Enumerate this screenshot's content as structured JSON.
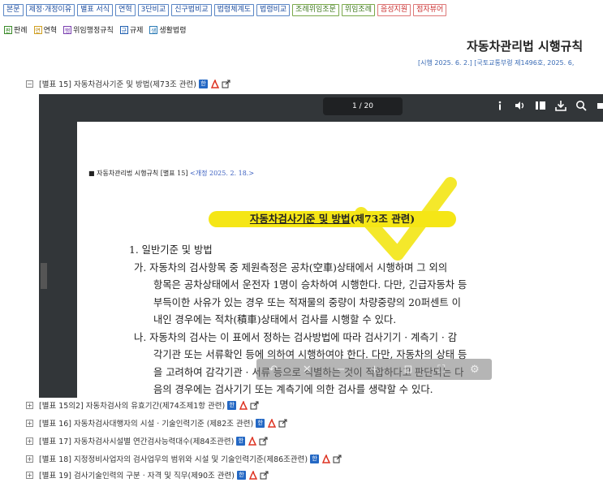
{
  "toolbar": {
    "buttons": [
      "본문",
      "제정·개정이유",
      "별표 서식",
      "연혁",
      "3단비교",
      "신구법비교",
      "법령체계도",
      "법령비교",
      "조례위임조문",
      "위임조례",
      "음성지원",
      "점자뷰어"
    ]
  },
  "legend": {
    "items": [
      {
        "icon": "판",
        "label": "판례"
      },
      {
        "icon": "연",
        "label": "연혁"
      },
      {
        "icon": "행",
        "label": "위임행정규칙"
      },
      {
        "icon": "규",
        "label": "규제"
      },
      {
        "icon": "생",
        "label": "생활법령"
      }
    ]
  },
  "law": {
    "title": "자동차관리법 시행규칙",
    "info": "[시행 2025. 6. 2.] [국토교통부령 제1496호, 2025. 6,"
  },
  "rows": {
    "top": "[별표 15] 자동차검사기준 및 방법(제73조 관련)",
    "list": [
      "[별표 15의2] 자동차검사의 유효기간(제74조제1항 관련)",
      "[별표 16] 자동차검사대행자의 시설 · 기술인력기준 (제82조 관련)",
      "[별표 17] 자동차검사시설별 연간검사능력대수(제84조관련)",
      "[별표 18] 지정정비사업자의 검사업무의 범위와 시설 및 기술인력기준(제86조관련)",
      "[별표 19] 검사기술인력의 구분 · 자격 및 직무(제90조 관련)"
    ]
  },
  "viewer": {
    "page_indicator": "1 / 20",
    "doc_header": "■ 자동차관리법 시행규칙 [별표 15]",
    "doc_revision": "<개정 2025. 2. 18.>",
    "doc_title": "자동차검사기준 및 방법",
    "doc_title_suffix": "(제73조 관련)",
    "section": "1. 일반기준 및 방법",
    "lines": [
      "가. 자동차의 검사항목 중 제원측정은 공차(空車)상태에서 시행하며 그 외의",
      "항목은 공차상태에서 운전자 1명이 승차하여 시행한다. 다만, 긴급자동차 등",
      "부득이한 사유가 있는 경우 또는 적재물의 중량이 차량중량의 20퍼센트 이",
      "내인 경우에는 적차(積車)상태에서 검사를 시행할 수 있다.",
      "나. 자동차의 검사는 이 표에서 정하는 검사방법에 따라 검사기기 · 계측기 · 감",
      "각기관 또는 서류확인 등에 의하여 시행하여야 한다. 다만, 자동차의 상태 등",
      "을 고려하여 감각기관 · 서류 등으로 식별하는 것이 적합하다고 판단되는 다",
      "음의 경우에는 검사기기 또는 계측기에 의한 검사를 생략할 수 있다."
    ]
  }
}
